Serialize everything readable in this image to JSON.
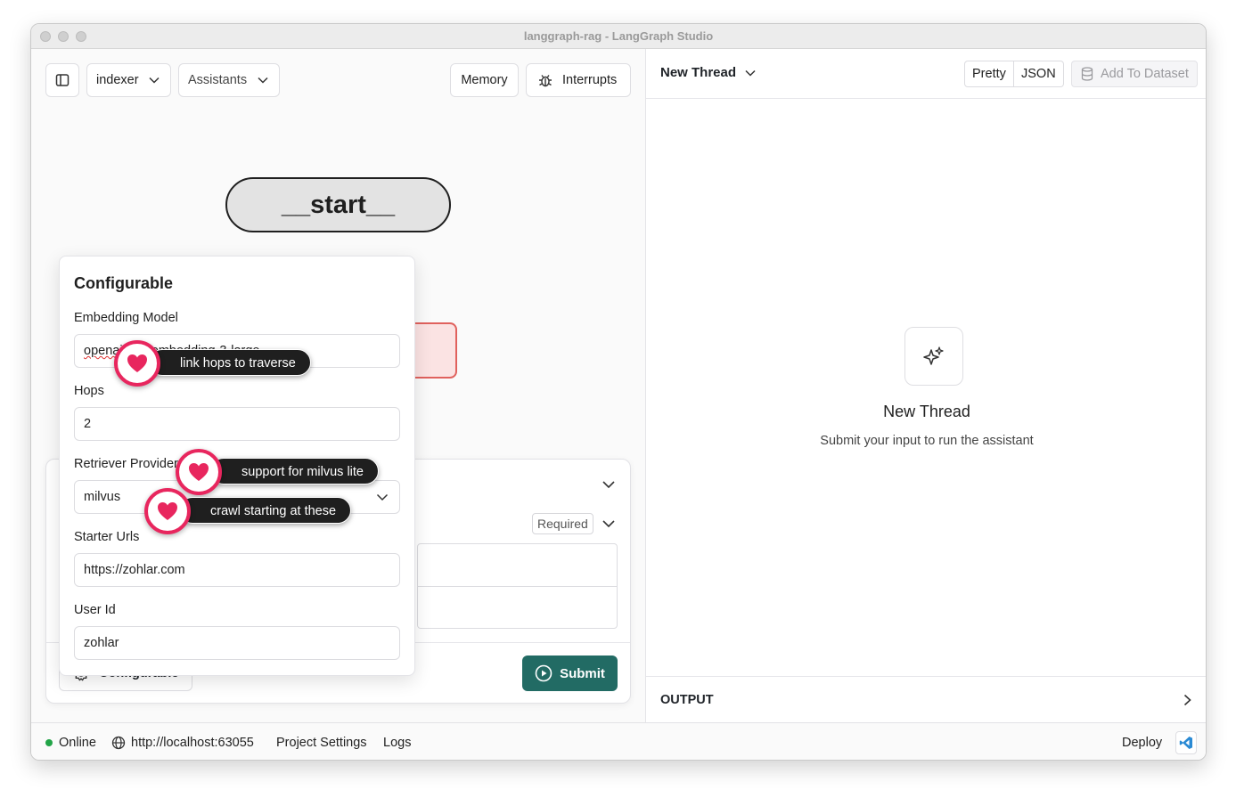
{
  "window": {
    "title": "langgraph-rag - LangGraph Studio"
  },
  "toolbar": {
    "graph_select": "indexer",
    "assistants_label": "Assistants",
    "memory_label": "Memory",
    "interrupts_label": "Interrupts"
  },
  "graph": {
    "start_node": "__start__"
  },
  "configurable_popover": {
    "title": "Configurable",
    "fields": [
      {
        "label": "Embedding Model",
        "value_prefix": "openai",
        "value_rest": "/text-embedding-3-large"
      },
      {
        "label": "Hops",
        "value": "2"
      },
      {
        "label": "Retriever Provider",
        "value": "milvus"
      },
      {
        "label": "Starter Urls",
        "value": "https://zohlar.com"
      },
      {
        "label": "User Id",
        "value": "zohlar"
      }
    ]
  },
  "annotations": [
    {
      "text": "link hops to traverse"
    },
    {
      "text": "support for milvus lite"
    },
    {
      "text": "crawl starting at these"
    }
  ],
  "input_panel": {
    "required_label": "Required",
    "configurable_label": "Configurable",
    "submit_label": "Submit"
  },
  "thread_panel": {
    "thread_title": "New Thread",
    "view_modes": [
      "Pretty",
      "JSON"
    ],
    "add_to_dataset_label": "Add To Dataset",
    "empty_title": "New Thread",
    "empty_subtitle": "Submit your input to run the assistant",
    "output_label": "OUTPUT"
  },
  "statusbar": {
    "status": "Online",
    "status_color": "#22a447",
    "url": "http://localhost:63055",
    "project_settings": "Project Settings",
    "logs": "Logs",
    "deploy": "Deploy"
  },
  "colors": {
    "accent": "#226b64",
    "heart": "#e8265e"
  }
}
